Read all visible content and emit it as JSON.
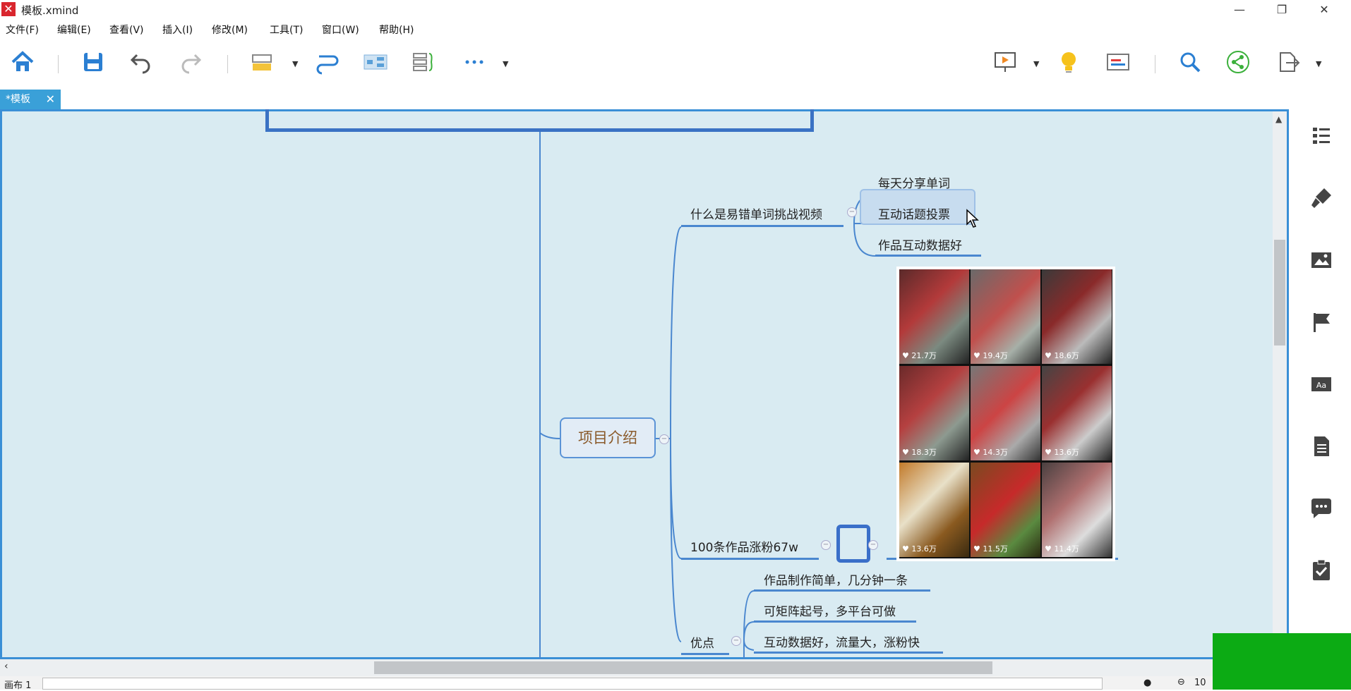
{
  "window": {
    "title": "模板.xmind",
    "app_icon": "xmind-logo-icon"
  },
  "menu": [
    "文件(F)",
    "编辑(E)",
    "查看(V)",
    "插入(I)",
    "修改(M)",
    "工具(T)",
    "窗口(W)",
    "帮助(H)"
  ],
  "tab": {
    "label": "*模板",
    "close": "✕"
  },
  "mindmap": {
    "central": "项目介绍",
    "branches": [
      {
        "label": "什么是易错单词挑战视频",
        "children": [
          "每天分享单词",
          "互动话题投票",
          "作品互动数据好"
        ]
      },
      {
        "label": "100条作品涨粉67w",
        "image_likes": [
          "21.7万",
          "19.4万",
          "18.6万",
          "18.3万",
          "14.3万",
          "13.6万",
          "13.6万",
          "11.5万",
          "11.4万"
        ]
      },
      {
        "label": "优点",
        "children": [
          "作品制作简单，几分钟一条",
          "可矩阵起号，多平台可做",
          "互动数据好，流量大，涨粉快"
        ]
      }
    ]
  },
  "statusbar": {
    "sheet": "画布 1",
    "zoom": "10"
  },
  "colors": {
    "accent": "#3a8fd6",
    "canvas": "#d9ebf2",
    "line": "#4a87cf"
  }
}
